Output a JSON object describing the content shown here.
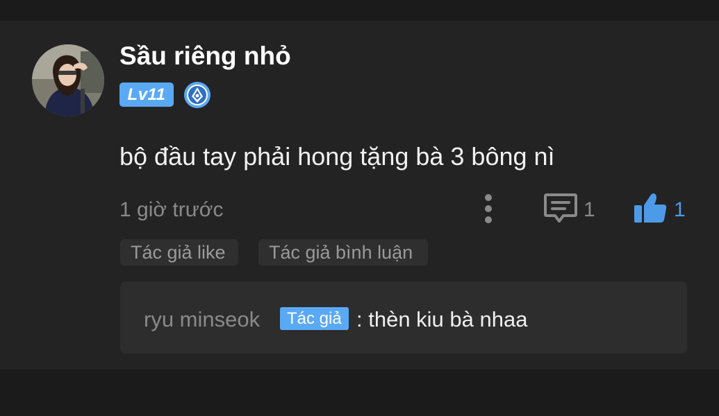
{
  "comment": {
    "username": "Sầu riêng nhỏ",
    "level": "Lv11",
    "badge_icon": "medal-icon",
    "text": "bộ đầu tay phải hong tặng bà 3 bông nì",
    "time": "1 giờ trước",
    "reply_count": "1",
    "like_count": "1",
    "tags": [
      "Tác giả like",
      "Tác giả bình luận"
    ]
  },
  "reply": {
    "author": "ryu minseok",
    "author_badge": "Tác giả",
    "text": ": thèn kiu bà nhaa"
  },
  "colors": {
    "background": "#1b1b1b",
    "card": "#232323",
    "accent": "#5aa9f5",
    "like": "#4d9be8"
  }
}
